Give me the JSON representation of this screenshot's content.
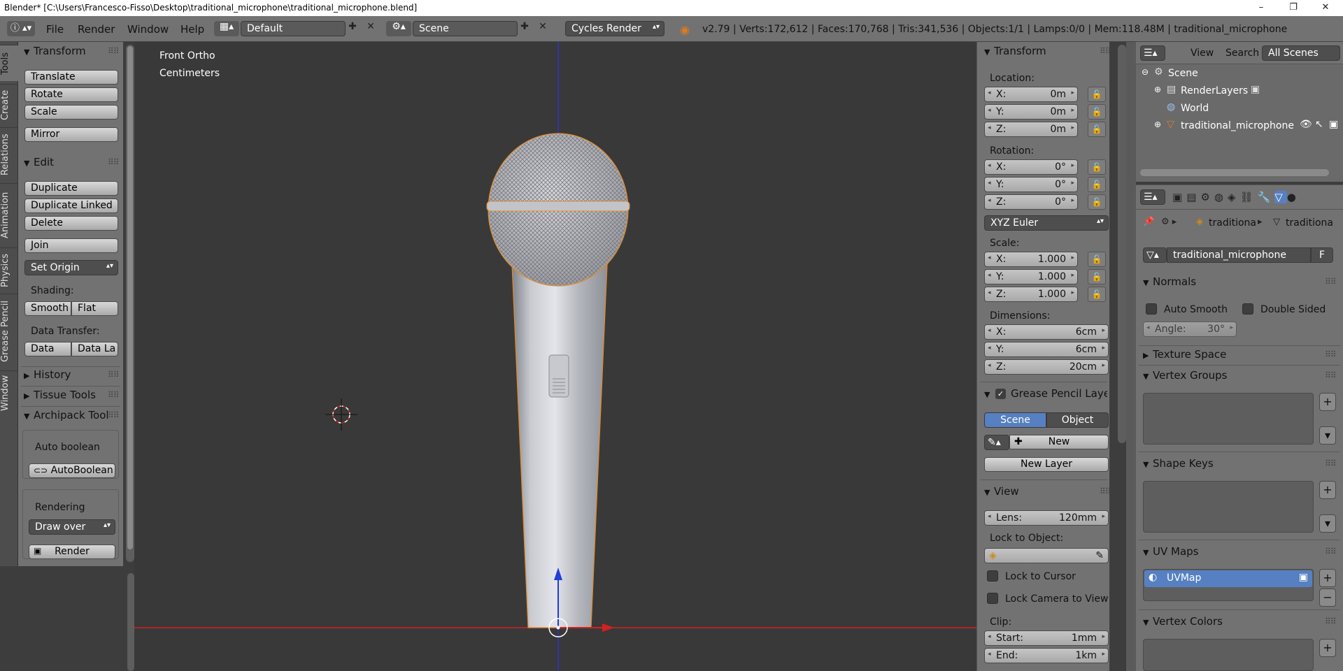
{
  "titlebar": {
    "title": "Blender* [C:\\Users\\Francesco-Fisso\\Desktop\\traditional_microphone\\traditional_microphone.blend]",
    "minimize": "–",
    "maximize": "❐",
    "close": "✕"
  },
  "infobar": {
    "menus": [
      "File",
      "Render",
      "Window",
      "Help"
    ],
    "layout": "Default",
    "scene": "Scene",
    "engine": "Cycles Render",
    "stats": "v2.79 | Verts:172,612 | Faces:170,768 | Tris:341,536 | Objects:1/1 | Lamps:0/0 | Mem:118.48M | traditional_microphone"
  },
  "tabs": [
    "Tools",
    "Create",
    "Relations",
    "Animation",
    "Physics",
    "Grease Pencil",
    "Window"
  ],
  "toolshelf": {
    "transform_title": "Transform",
    "translate": "Translate",
    "rotate": "Rotate",
    "scale": "Scale",
    "mirror": "Mirror",
    "edit_title": "Edit",
    "duplicate": "Duplicate",
    "duplicate_linked": "Duplicate Linked",
    "delete": "Delete",
    "join": "Join",
    "set_origin": "Set Origin",
    "shading_label": "Shading:",
    "smooth": "Smooth",
    "flat": "Flat",
    "data_transfer_label": "Data Transfer:",
    "data": "Data",
    "data_la": "Data La",
    "history": "History",
    "tissue": "Tissue Tools",
    "archipack": "Archipack Tools",
    "auto_boolean_label": "Auto boolean",
    "auto_boolean_btn": "AutoBoolean",
    "rendering_label": "Rendering",
    "draw_over": "Draw over",
    "render": "Render"
  },
  "viewport": {
    "view_name": "Front Ortho",
    "units": "Centimeters"
  },
  "npanel": {
    "transform_title": "Transform",
    "location_label": "Location:",
    "location": [
      {
        "k": "X:",
        "v": "0m"
      },
      {
        "k": "Y:",
        "v": "0m"
      },
      {
        "k": "Z:",
        "v": "0m"
      }
    ],
    "rotation_label": "Rotation:",
    "rotation": [
      {
        "k": "X:",
        "v": "0°"
      },
      {
        "k": "Y:",
        "v": "0°"
      },
      {
        "k": "Z:",
        "v": "0°"
      }
    ],
    "rotation_mode": "XYZ Euler",
    "scale_label": "Scale:",
    "scale": [
      {
        "k": "X:",
        "v": "1.000"
      },
      {
        "k": "Y:",
        "v": "1.000"
      },
      {
        "k": "Z:",
        "v": "1.000"
      }
    ],
    "dimensions_label": "Dimensions:",
    "dimensions": [
      {
        "k": "X:",
        "v": "6cm"
      },
      {
        "k": "Y:",
        "v": "6cm"
      },
      {
        "k": "Z:",
        "v": "20cm"
      }
    ],
    "grease_title": "Grease Pencil Layer",
    "scene_btn": "Scene",
    "object_btn": "Object",
    "new_btn": "New",
    "new_layer_btn": "New Layer",
    "view_title": "View",
    "lens_label": "Lens:",
    "lens_value": "120mm",
    "lock_object_label": "Lock to Object:",
    "lock_cursor": "Lock to Cursor",
    "lock_camera": "Lock Camera to View",
    "clip_label": "Clip:",
    "clip_start_label": "Start:",
    "clip_start": "1mm",
    "clip_end_label": "End:",
    "clip_end": "1km"
  },
  "outliner": {
    "view": "View",
    "search": "Search",
    "all_scenes": "All Scenes",
    "items": [
      "Scene",
      "RenderLayers",
      "World",
      "traditional_microphone"
    ]
  },
  "properties": {
    "crumb1": "traditiona",
    "crumb2": "traditiona",
    "mesh_name": "traditional_microphone",
    "fake_user": "F",
    "normals_title": "Normals",
    "auto_smooth": "Auto Smooth",
    "double_sided": "Double Sided",
    "angle_label": "Angle:",
    "angle_value": "30°",
    "texture_space": "Texture Space",
    "vertex_groups": "Vertex Groups",
    "shape_keys": "Shape Keys",
    "uv_maps": "UV Maps",
    "uvmap_item": "UVMap",
    "vertex_colors": "Vertex Colors"
  }
}
